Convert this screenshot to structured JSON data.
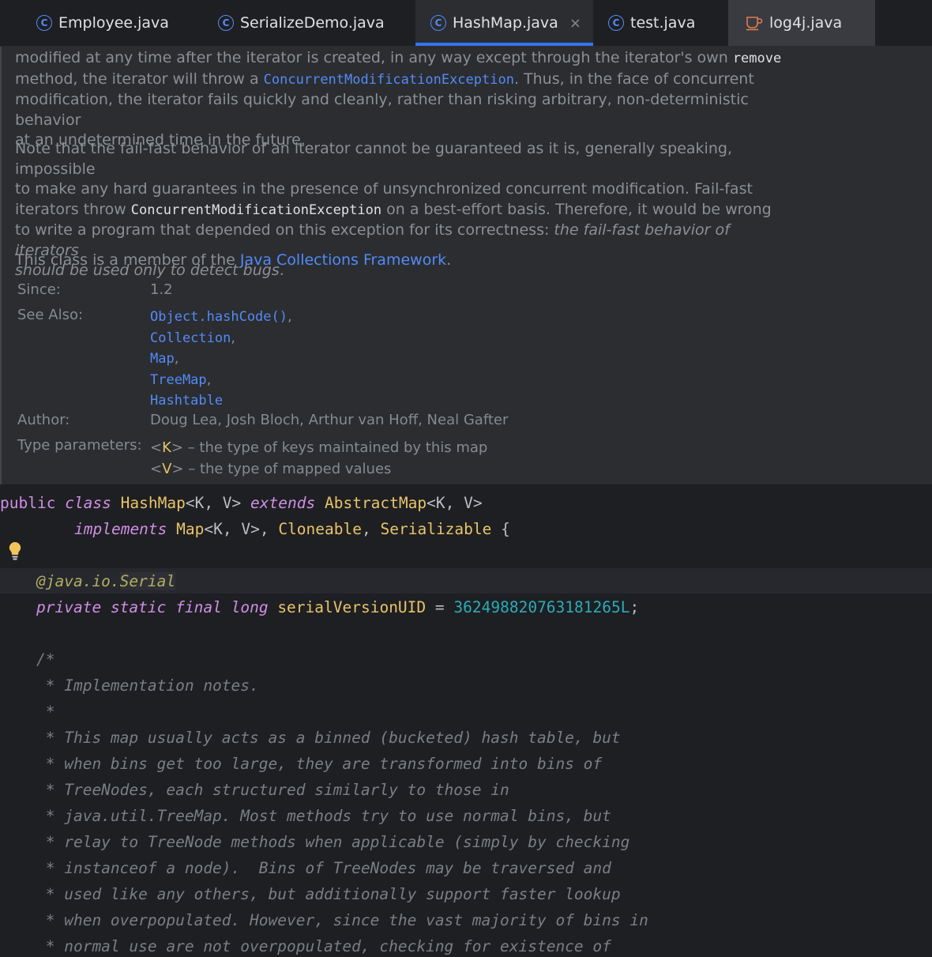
{
  "tabs": [
    {
      "label": "Employee.java",
      "icon": "class-icon"
    },
    {
      "label": "SerializeDemo.java",
      "icon": "class-icon"
    },
    {
      "label": "HashMap.java",
      "icon": "class-icon",
      "active": true
    },
    {
      "label": "test.java",
      "icon": "class-icon"
    },
    {
      "label": "log4j.java",
      "icon": "coffee-cup-icon"
    }
  ],
  "close_glyph": "×",
  "doc": {
    "p1_l1_text": "modified at any time after the iterator is created, in any way except through the iterator's own ",
    "p1_l1_code": "remove",
    "p1_l2_a": "method, the iterator will throw a ",
    "p1_l2_link": "ConcurrentModificationException",
    "p1_l2_b": ". Thus, in the face of concurrent",
    "p1_l3": "modification, the iterator fails quickly and cleanly, rather than risking arbitrary, non-deterministic behavior",
    "p1_l4": "at an undetermined time in the future.",
    "p2_l1": "Note that the fail-fast behavior of an iterator cannot be guaranteed as it is, generally speaking, impossible",
    "p2_l2": "to make any hard guarantees in the presence of unsynchronized concurrent modification. Fail-fast",
    "p2_l3_a": "iterators throw ",
    "p2_l3_code": "ConcurrentModificationException",
    "p2_l3_b": " on a best-effort basis. Therefore, it would be wrong",
    "p2_l4_a": "to write a program that depended on this exception for its correctness: ",
    "p2_l4_i": "the fail-fast behavior of iterators",
    "p2_l5_i": "should be used only to detect bugs",
    "p2_l5_b": ".",
    "p3_a": "This class is a member of the ",
    "p3_link": "Java Collections Framework",
    "p3_b": ".",
    "since_label": "Since:",
    "since_value": "1.2",
    "see_also_label": "See Also:",
    "see_also": [
      "Object.hashCode()",
      "Collection",
      "Map",
      "TreeMap",
      "Hashtable"
    ],
    "see_also_sep": ",",
    "author_label": "Author:",
    "author_value": "Doug Lea, Josh Bloch, Arthur van Hoff, Neal Gafter",
    "type_params_label": "Type parameters:",
    "tp_k_lt": "<",
    "tp_k": "K",
    "tp_k_rest": "> – the type of keys maintained by this map",
    "tp_v_lt": "<",
    "tp_v": "V",
    "tp_v_rest": "> – the type of mapped values"
  },
  "code": {
    "l1": {
      "kw1": "public",
      "kw2": "class",
      "name": "HashMap",
      "gen1": "<K, V>",
      "kw3": "extends",
      "sup": "AbstractMap",
      "gen2": "<K, V>"
    },
    "l2": {
      "kw": "implements",
      "t1": "Map",
      "g": "<K, V>,",
      "t2": "Cloneable",
      "c": ",",
      "t3": "Serializable",
      "brace": "{"
    },
    "l3": {
      "anno_prefix": "@java.io.",
      "anno_name": "Serial"
    },
    "l4": {
      "kw1": "private",
      "kw2": "static",
      "kw3": "final",
      "kw4": "long",
      "field": "serialVersionUID",
      "eq": "=",
      "num": "362498820763181265L",
      "semi": ";"
    },
    "comment_lines": [
      "/*",
      " * Implementation notes.",
      " *",
      " * This map usually acts as a binned (bucketed) hash table, but",
      " * when bins get too large, they are transformed into bins of",
      " * TreeNodes, each structured similarly to those in",
      " * java.util.TreeMap. Most methods try to use normal bins, but",
      " * relay to TreeNode methods when applicable (simply by checking",
      " * instanceof a node).  Bins of TreeNodes may be traversed and",
      " * used like any others, but additionally support faster lookup",
      " * when overpopulated. However, since the vast majority of bins in",
      " * normal use are not overpopulated, checking for existence of"
    ]
  },
  "colors": {
    "accent": "#3574f0",
    "link": "#548af7",
    "keyword": "#cf8ee6",
    "type": "#e8c46a",
    "number": "#2aacb8",
    "comment": "#7a7e85"
  }
}
